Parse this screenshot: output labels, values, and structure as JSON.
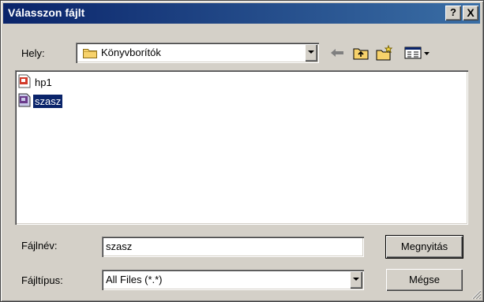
{
  "window": {
    "title": "Válasszon fájlt",
    "help_label": "?",
    "close_label": "X"
  },
  "lookin": {
    "label": "Hely:",
    "value": "Könyvborítók",
    "icon": "folder-icon"
  },
  "toolbar": {
    "back_icon": "back-arrow-icon",
    "up_icon": "up-folder-icon",
    "new_folder_icon": "new-folder-icon",
    "view_icon": "view-menu-icon"
  },
  "files": [
    {
      "name": "hp1",
      "icon": "image-file-icon",
      "selected": false
    },
    {
      "name": "szasz",
      "icon": "image-file-icon",
      "selected": true
    }
  ],
  "filename": {
    "label": "Fájlnév:",
    "value": "szasz"
  },
  "filetype": {
    "label": "Fájltípus:",
    "value": "All Files (*.*)"
  },
  "buttons": {
    "open_label": "Megnyitás",
    "cancel_label": "Mégse"
  },
  "colors": {
    "title_start": "#0a246a",
    "title_end": "#3a6ea5",
    "selection": "#0a246a",
    "face": "#d4d0c8"
  }
}
